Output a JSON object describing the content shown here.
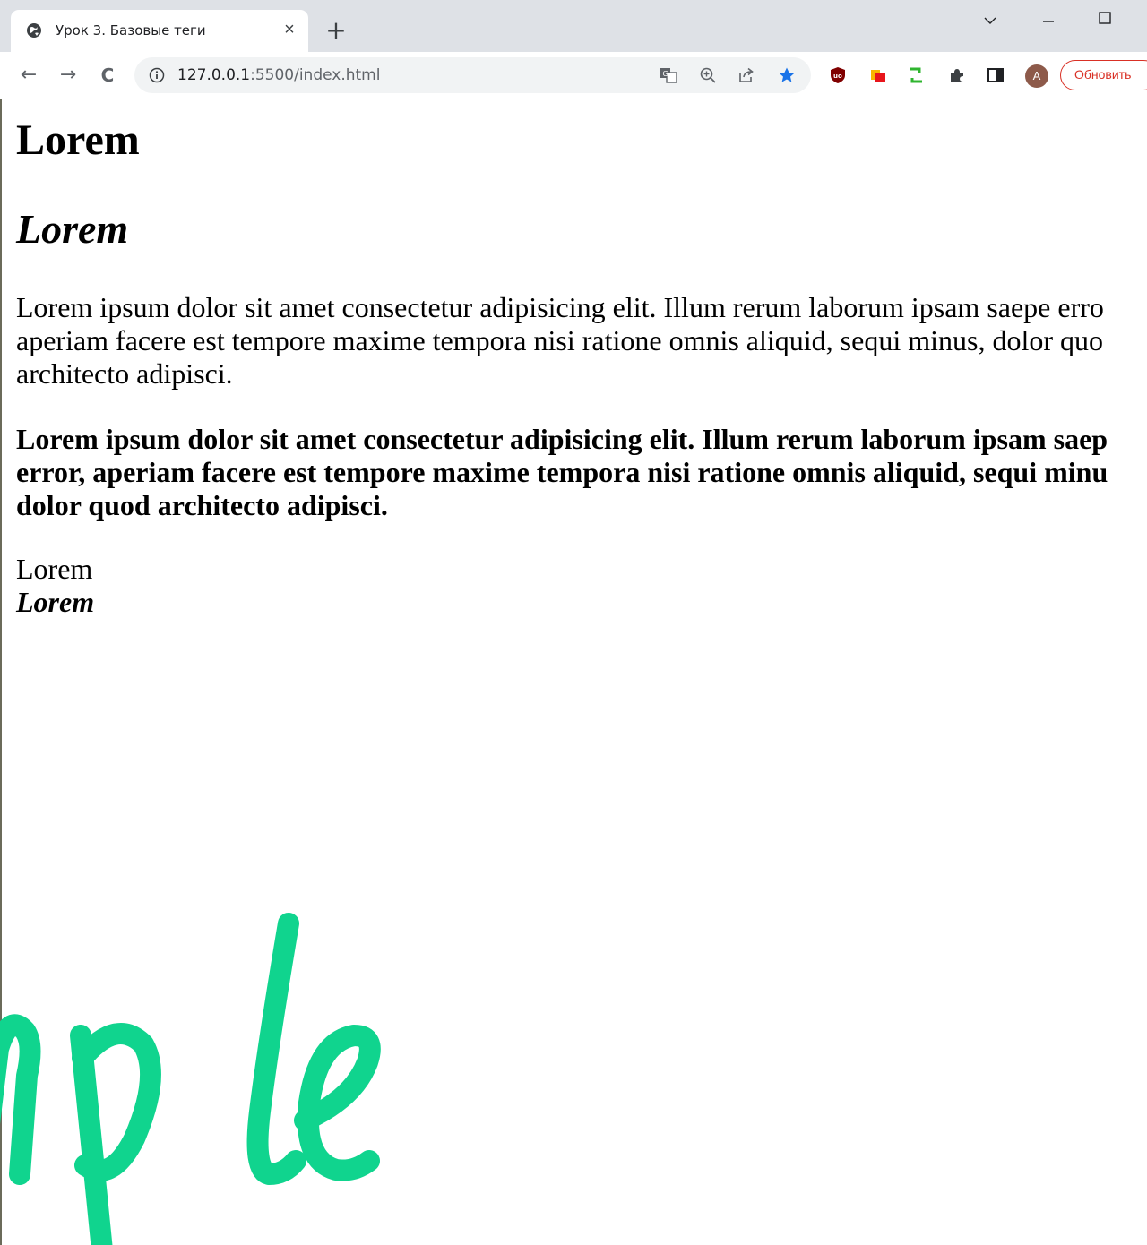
{
  "browser": {
    "tab": {
      "title": "Урок 3. Базовые теги",
      "close_glyph": "×",
      "favicon": "globe-icon"
    },
    "new_tab_glyph": "+",
    "window_controls": [
      "chevron-down-icon",
      "minimize-icon",
      "maximize-icon"
    ],
    "nav": {
      "back_glyph": "←",
      "forward_glyph": "→",
      "reload_glyph": "C"
    },
    "address": {
      "host": "127.0.0.1",
      "path": ":5500/index.html"
    },
    "omnibox_icons": [
      "translate-icon",
      "zoom-icon",
      "share-icon",
      "bookmark-star-icon"
    ],
    "extension_icons": [
      "ublock-icon",
      "office-icon",
      "green-bracket-icon",
      "puzzle-icon",
      "side-panel-icon"
    ],
    "avatar_letter": "A",
    "update_label": "Обновить",
    "colors": {
      "tabstrip": "#dee1e6",
      "star": "#1a73e8",
      "update": "#d93025",
      "watermark": "#10d48e"
    }
  },
  "page": {
    "h1": "Lorem",
    "h2": "Lorem",
    "paragraph1_lines": [
      "Lorem ipsum dolor sit amet consectetur adipisicing elit. Illum rerum laborum ipsam saepe erro",
      "aperiam facere est tempore maxime tempora nisi ratione omnis aliquid, sequi minus, dolor quo",
      "architecto adipisci."
    ],
    "paragraph2_lines": [
      "Lorem ipsum dolor sit amet consectetur adipisicing elit. Illum rerum laborum ipsam saep",
      "error, aperiam facere est tempore maxime tempora nisi ratione omnis aliquid, sequi minu",
      "dolor quod architecto adipisci."
    ],
    "plain_word": "Lorem",
    "bold_italic_word": "Lorem",
    "watermark_text": "mple"
  }
}
